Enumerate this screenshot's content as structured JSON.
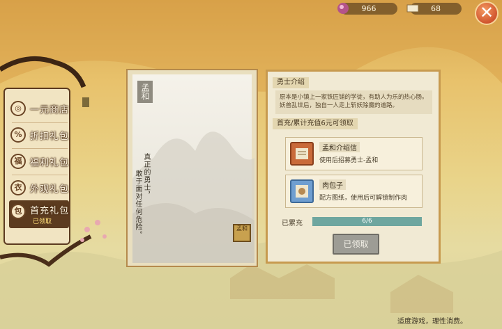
{
  "topbar": {
    "gems": "966",
    "tickets": "68",
    "close_icon": "close-icon"
  },
  "menu": {
    "items": [
      {
        "label": "一元商店",
        "icon": "coin-icon"
      },
      {
        "label": "折扣礼包",
        "icon": "discount-icon"
      },
      {
        "label": "福利礼包",
        "icon": "gift-jar-icon"
      },
      {
        "label": "外观礼包",
        "icon": "outfit-icon"
      },
      {
        "label": "首充礼包",
        "icon": "bag-icon",
        "sub": "已领取"
      }
    ]
  },
  "hero": {
    "name": "孟和",
    "quote1": "真正的勇士，",
    "quote2": "敢于面对任何危险。",
    "stamp": "孟和"
  },
  "intro": {
    "title": "勇士介绍",
    "text": "原本是小镇上一家铁匠铺的学徒，有助人为乐的热心肠。妖兽乱世后，独自一人走上斩妖除魔的道路。"
  },
  "reward": {
    "title": "首充/累计充值6元可领取",
    "items": [
      {
        "name": "孟和介绍信",
        "desc": "使用后招募勇士-孟和",
        "icon": "letter-icon"
      },
      {
        "name": "肉包子",
        "desc": "配方图纸，使用后可解锁制作肉",
        "icon": "bun-recipe-icon"
      }
    ],
    "progress_label": "已累充",
    "progress_text": "6/6",
    "progress_fraction": 1.0,
    "claim_label": "已领取"
  },
  "footer": "适度游戏，理性消费。",
  "colors": {
    "accent": "#c79a4f",
    "progress": "#6ea69f"
  }
}
